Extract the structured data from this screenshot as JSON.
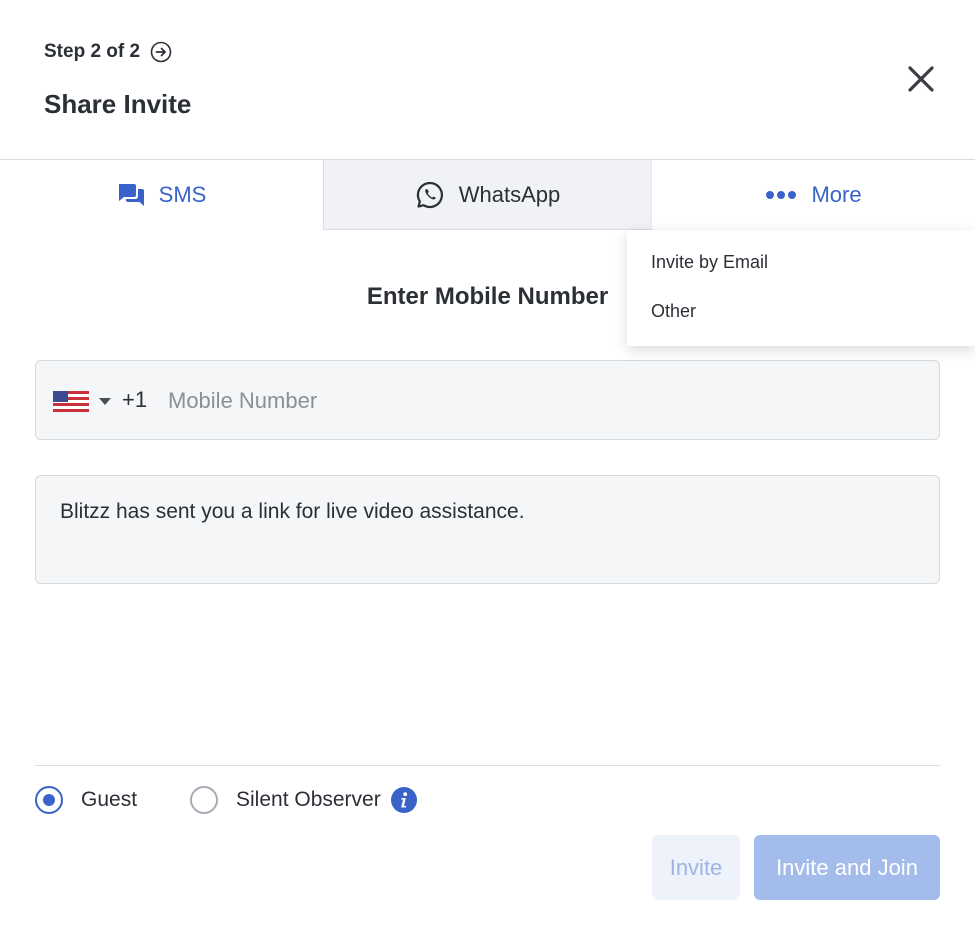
{
  "header": {
    "step_text": "Step 2 of 2",
    "title": "Share Invite"
  },
  "tabs": [
    {
      "label": "SMS",
      "icon": "chat-bubbles-icon",
      "active": true
    },
    {
      "label": "WhatsApp",
      "icon": "whatsapp-icon",
      "active": false
    },
    {
      "label": "More",
      "icon": "more-dots-icon",
      "active": false
    }
  ],
  "more_menu": {
    "items": [
      "Invite by Email",
      "Other"
    ]
  },
  "form": {
    "section_title": "Enter Mobile Number",
    "country_flag": "us-flag-icon",
    "dial_code": "+1",
    "phone_placeholder": "Mobile Number",
    "phone_value": "",
    "message": "Blitzz has sent you a link for live video assistance."
  },
  "roles": {
    "options": [
      {
        "label": "Guest",
        "selected": true
      },
      {
        "label": "Silent Observer",
        "selected": false
      }
    ]
  },
  "actions": {
    "invite_label": "Invite",
    "invite_join_label": "Invite and Join"
  },
  "colors": {
    "accent": "#3a63c9",
    "tab_inactive_bg": "#f0f2f6",
    "button_disabled_bg": "#a3bcec"
  }
}
